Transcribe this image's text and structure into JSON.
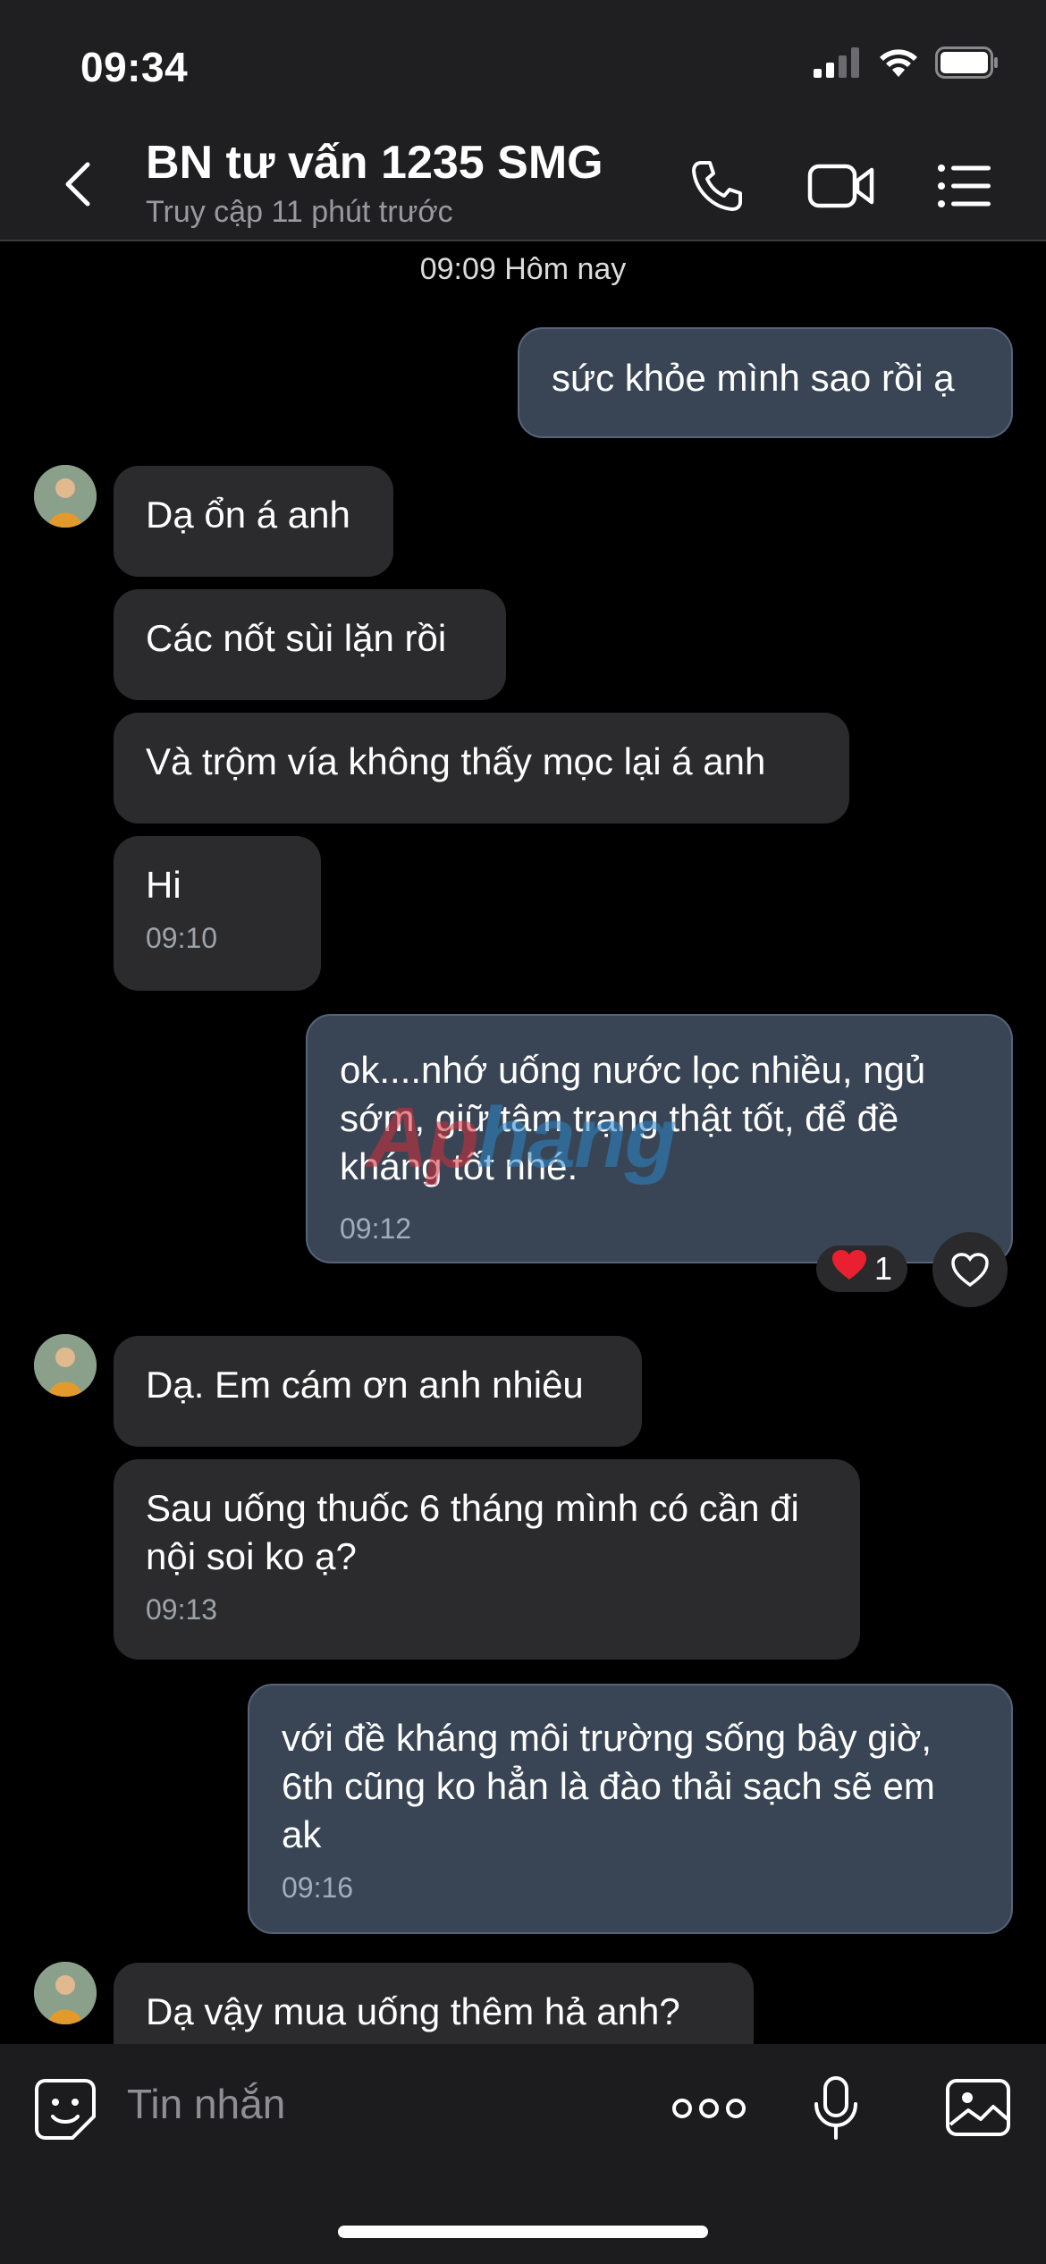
{
  "status_bar": {
    "time": "09:34"
  },
  "header": {
    "title": "BN tư vấn 1235 SMG",
    "subtitle": "Truy cập 11 phút trước",
    "icons": [
      "chevron-left-icon",
      "phone-icon",
      "video-camera-icon",
      "menu-list-icon"
    ]
  },
  "chat": {
    "date_separator": "09:09 Hôm nay",
    "messages": [
      {
        "side": "out",
        "text": "sức khỏe mình sao rồi ạ",
        "time": ""
      },
      {
        "side": "in",
        "text": "Dạ ổn á anh",
        "time": ""
      },
      {
        "side": "in",
        "text": "Các nốt sùi lặn rồi",
        "time": ""
      },
      {
        "side": "in",
        "text": "Và trộm vía không thấy mọc lại á anh",
        "time": ""
      },
      {
        "side": "in",
        "text": "Hi",
        "time": "09:10"
      },
      {
        "side": "out",
        "text": "ok....nhớ uống nước lọc nhiều, ngủ sớm, giữ tâm trạng thật tốt, để đề kháng tốt nhé.",
        "time": "09:12"
      },
      {
        "side": "in",
        "text": "Dạ. Em cám ơn anh nhiêu",
        "time": ""
      },
      {
        "side": "in",
        "text": "Sau uống thuốc 6 tháng mình có cần đi nội soi ko ạ?",
        "time": "09:13"
      },
      {
        "side": "out",
        "text": "với đề kháng môi trường sống bây giờ, 6th cũng ko hẳn là đào thải sạch sẽ em ak",
        "time": "09:16"
      },
      {
        "side": "in",
        "text": "Dạ vậy mua uống thêm hả anh?",
        "time": ""
      }
    ],
    "reaction": {
      "emoji": "❤️",
      "count": "1"
    },
    "watermark": {
      "part1": "Ap",
      "part2": "hang"
    }
  },
  "composer": {
    "placeholder": "Tin nhắn",
    "icons": [
      "sticker-icon",
      "more-icon",
      "microphone-icon",
      "image-icon"
    ]
  },
  "colors": {
    "incoming_bubble": "#2b2b2d",
    "outgoing_bubble": "#394555",
    "background": "#000000",
    "header": "#1f1f21"
  }
}
